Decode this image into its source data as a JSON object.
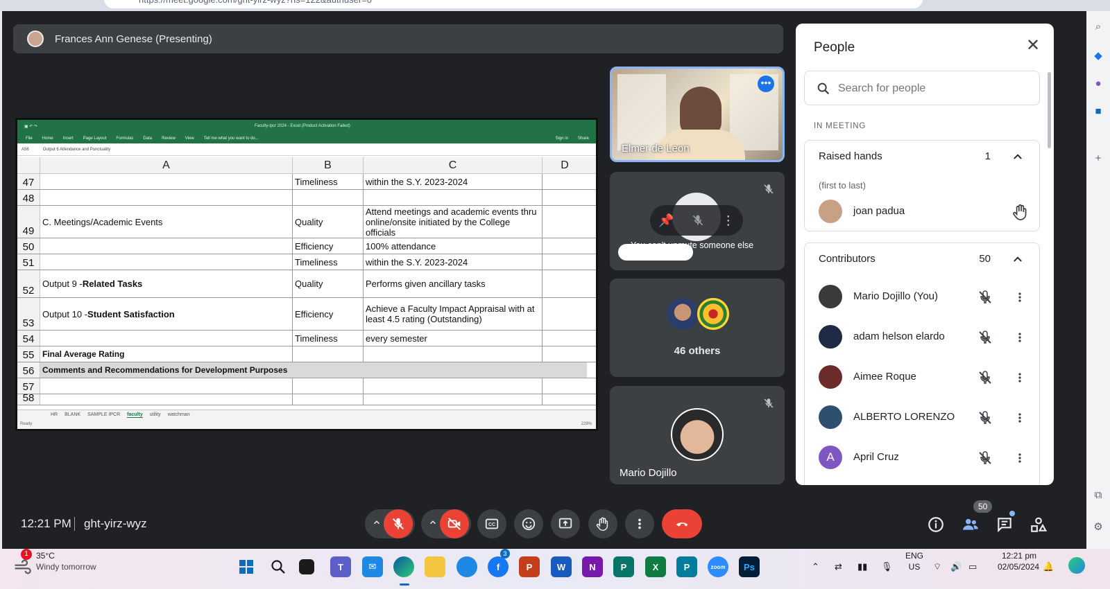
{
  "browser": {
    "url": "https://meet.google.com/ght-yirz-wyz?hs=122&authuser=0"
  },
  "presenter": {
    "label": "Frances Ann Genese (Presenting)"
  },
  "spreadsheet": {
    "window_title": "Faculty-ipcr 2024 - Excel (Product Activation Failed)",
    "menu": [
      "File",
      "Home",
      "Insert",
      "Page Layout",
      "Formulas",
      "Data",
      "Review",
      "View",
      "Tell me what you want to do..."
    ],
    "account": [
      "Sign in",
      "Share"
    ],
    "name_box": "A56",
    "formula_text": "Output 6   Attendance and Punctuality",
    "columns": [
      "A",
      "B",
      "C",
      "D"
    ],
    "rows": [
      {
        "num": "47",
        "a": "",
        "b": "Timeliness",
        "c": "within the S.Y. 2023-2024",
        "h": 23
      },
      {
        "num": "48",
        "a": "",
        "b": "",
        "c": "",
        "h": 23
      },
      {
        "num": "49",
        "a": "C. Meetings/Academic Events",
        "b": "Quality",
        "c": "Attend meetings and academic events thru online/onsite initiated by the College officials",
        "h": 47
      },
      {
        "num": "50",
        "a": "",
        "b": "Efficiency",
        "c": "100% attendance",
        "h": 23
      },
      {
        "num": "51",
        "a": "",
        "b": "Timeliness",
        "c": "within the S.Y. 2023-2024",
        "h": 23
      },
      {
        "num": "52",
        "a": "Output 9 - ",
        "a_bold": "Related Tasks",
        "b": "Quality",
        "c": "Performs given ancillary tasks",
        "h": 40
      },
      {
        "num": "53",
        "a": "Output 10  - ",
        "a_bold": "Student Satisfaction",
        "b": "Efficiency",
        "c": "Achieve a Faculty Impact Appraisal with at least 4.5 rating (Outstanding)",
        "h": 47
      },
      {
        "num": "54",
        "a": "",
        "b": "Timeliness",
        "c": "every semester",
        "h": 23
      },
      {
        "num": "55",
        "a": "",
        "a_bold": "Final Average Rating",
        "b": "",
        "c": "",
        "h": 23
      },
      {
        "num": "56",
        "a": "",
        "a_bold": "Comments and Recommendations for Development Purposes",
        "b": "",
        "c": "",
        "h": 23,
        "merged": true
      },
      {
        "num": "57",
        "a": "",
        "b": "",
        "c": "",
        "h": 23
      },
      {
        "num": "58",
        "a": "",
        "b": "",
        "c": "",
        "h": 16
      }
    ],
    "sheet_tabs": [
      "HR",
      "BLANK",
      "SAMPLE IPCR",
      "faculty",
      "utility",
      "watchman"
    ],
    "active_sheet": "faculty",
    "status": "Ready",
    "zoom": "228%"
  },
  "tiles": {
    "elmer": {
      "name": "Elmer de Leon"
    },
    "joan": {
      "name": "joan padua",
      "tooltip": "You can't unmute someone else"
    },
    "others": {
      "label": "46 others"
    },
    "mario": {
      "name": "Mario Dojillo"
    }
  },
  "people_panel": {
    "title": "People",
    "search_placeholder": "Search for people",
    "section": "IN MEETING",
    "raised_hands": {
      "title": "Raised hands",
      "count": "1",
      "sub": "(first to last)",
      "people": [
        {
          "name": "joan padua",
          "avatar_color": "#c8a083"
        }
      ]
    },
    "contributors": {
      "title": "Contributors",
      "count": "50",
      "people": [
        {
          "name": "Mario Dojillo (You)",
          "avatar_color": "#3a3a3a"
        },
        {
          "name": "adam helson elardo",
          "avatar_color": "#1f2a44"
        },
        {
          "name": "Aimee Roque",
          "avatar_color": "#6b2b2b"
        },
        {
          "name": "ALBERTO LORENZO",
          "avatar_color": "#2f4f6f"
        },
        {
          "name": "April Cruz",
          "avatar_color": "#7e57c2",
          "initial": "A"
        }
      ]
    }
  },
  "bottom_bar": {
    "time": "12:21 PM",
    "meeting_code": "ght-yirz-wyz",
    "people_badge": "50",
    "colors": {
      "end_call": "#ea4335",
      "mic_off": "#ea4335",
      "control": "#3c4043"
    }
  },
  "taskbar": {
    "weather_badge": "1",
    "temperature": "35°C",
    "weather": "Windy tomorrow",
    "facebook_badge": "3",
    "language": "ENG",
    "region": "US",
    "time": "12:21 pm",
    "date": "02/05/2024"
  }
}
